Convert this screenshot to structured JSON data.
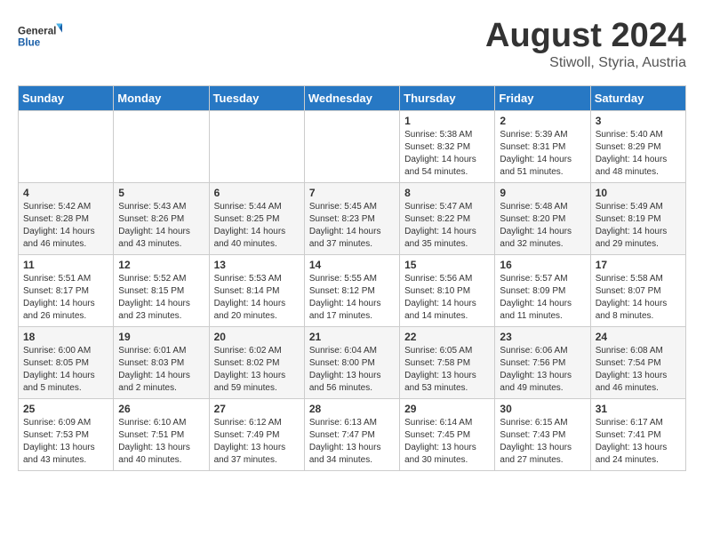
{
  "logo": {
    "text_general": "General",
    "text_blue": "Blue"
  },
  "title": "August 2024",
  "subtitle": "Stiwoll, Styria, Austria",
  "weekdays": [
    "Sunday",
    "Monday",
    "Tuesday",
    "Wednesday",
    "Thursday",
    "Friday",
    "Saturday"
  ],
  "weeks": [
    [
      {
        "day": "",
        "sunrise": "",
        "sunset": "",
        "daylight": ""
      },
      {
        "day": "",
        "sunrise": "",
        "sunset": "",
        "daylight": ""
      },
      {
        "day": "",
        "sunrise": "",
        "sunset": "",
        "daylight": ""
      },
      {
        "day": "",
        "sunrise": "",
        "sunset": "",
        "daylight": ""
      },
      {
        "day": "1",
        "sunrise": "Sunrise: 5:38 AM",
        "sunset": "Sunset: 8:32 PM",
        "daylight": "Daylight: 14 hours and 54 minutes."
      },
      {
        "day": "2",
        "sunrise": "Sunrise: 5:39 AM",
        "sunset": "Sunset: 8:31 PM",
        "daylight": "Daylight: 14 hours and 51 minutes."
      },
      {
        "day": "3",
        "sunrise": "Sunrise: 5:40 AM",
        "sunset": "Sunset: 8:29 PM",
        "daylight": "Daylight: 14 hours and 48 minutes."
      }
    ],
    [
      {
        "day": "4",
        "sunrise": "Sunrise: 5:42 AM",
        "sunset": "Sunset: 8:28 PM",
        "daylight": "Daylight: 14 hours and 46 minutes."
      },
      {
        "day": "5",
        "sunrise": "Sunrise: 5:43 AM",
        "sunset": "Sunset: 8:26 PM",
        "daylight": "Daylight: 14 hours and 43 minutes."
      },
      {
        "day": "6",
        "sunrise": "Sunrise: 5:44 AM",
        "sunset": "Sunset: 8:25 PM",
        "daylight": "Daylight: 14 hours and 40 minutes."
      },
      {
        "day": "7",
        "sunrise": "Sunrise: 5:45 AM",
        "sunset": "Sunset: 8:23 PM",
        "daylight": "Daylight: 14 hours and 37 minutes."
      },
      {
        "day": "8",
        "sunrise": "Sunrise: 5:47 AM",
        "sunset": "Sunset: 8:22 PM",
        "daylight": "Daylight: 14 hours and 35 minutes."
      },
      {
        "day": "9",
        "sunrise": "Sunrise: 5:48 AM",
        "sunset": "Sunset: 8:20 PM",
        "daylight": "Daylight: 14 hours and 32 minutes."
      },
      {
        "day": "10",
        "sunrise": "Sunrise: 5:49 AM",
        "sunset": "Sunset: 8:19 PM",
        "daylight": "Daylight: 14 hours and 29 minutes."
      }
    ],
    [
      {
        "day": "11",
        "sunrise": "Sunrise: 5:51 AM",
        "sunset": "Sunset: 8:17 PM",
        "daylight": "Daylight: 14 hours and 26 minutes."
      },
      {
        "day": "12",
        "sunrise": "Sunrise: 5:52 AM",
        "sunset": "Sunset: 8:15 PM",
        "daylight": "Daylight: 14 hours and 23 minutes."
      },
      {
        "day": "13",
        "sunrise": "Sunrise: 5:53 AM",
        "sunset": "Sunset: 8:14 PM",
        "daylight": "Daylight: 14 hours and 20 minutes."
      },
      {
        "day": "14",
        "sunrise": "Sunrise: 5:55 AM",
        "sunset": "Sunset: 8:12 PM",
        "daylight": "Daylight: 14 hours and 17 minutes."
      },
      {
        "day": "15",
        "sunrise": "Sunrise: 5:56 AM",
        "sunset": "Sunset: 8:10 PM",
        "daylight": "Daylight: 14 hours and 14 minutes."
      },
      {
        "day": "16",
        "sunrise": "Sunrise: 5:57 AM",
        "sunset": "Sunset: 8:09 PM",
        "daylight": "Daylight: 14 hours and 11 minutes."
      },
      {
        "day": "17",
        "sunrise": "Sunrise: 5:58 AM",
        "sunset": "Sunset: 8:07 PM",
        "daylight": "Daylight: 14 hours and 8 minutes."
      }
    ],
    [
      {
        "day": "18",
        "sunrise": "Sunrise: 6:00 AM",
        "sunset": "Sunset: 8:05 PM",
        "daylight": "Daylight: 14 hours and 5 minutes."
      },
      {
        "day": "19",
        "sunrise": "Sunrise: 6:01 AM",
        "sunset": "Sunset: 8:03 PM",
        "daylight": "Daylight: 14 hours and 2 minutes."
      },
      {
        "day": "20",
        "sunrise": "Sunrise: 6:02 AM",
        "sunset": "Sunset: 8:02 PM",
        "daylight": "Daylight: 13 hours and 59 minutes."
      },
      {
        "day": "21",
        "sunrise": "Sunrise: 6:04 AM",
        "sunset": "Sunset: 8:00 PM",
        "daylight": "Daylight: 13 hours and 56 minutes."
      },
      {
        "day": "22",
        "sunrise": "Sunrise: 6:05 AM",
        "sunset": "Sunset: 7:58 PM",
        "daylight": "Daylight: 13 hours and 53 minutes."
      },
      {
        "day": "23",
        "sunrise": "Sunrise: 6:06 AM",
        "sunset": "Sunset: 7:56 PM",
        "daylight": "Daylight: 13 hours and 49 minutes."
      },
      {
        "day": "24",
        "sunrise": "Sunrise: 6:08 AM",
        "sunset": "Sunset: 7:54 PM",
        "daylight": "Daylight: 13 hours and 46 minutes."
      }
    ],
    [
      {
        "day": "25",
        "sunrise": "Sunrise: 6:09 AM",
        "sunset": "Sunset: 7:53 PM",
        "daylight": "Daylight: 13 hours and 43 minutes."
      },
      {
        "day": "26",
        "sunrise": "Sunrise: 6:10 AM",
        "sunset": "Sunset: 7:51 PM",
        "daylight": "Daylight: 13 hours and 40 minutes."
      },
      {
        "day": "27",
        "sunrise": "Sunrise: 6:12 AM",
        "sunset": "Sunset: 7:49 PM",
        "daylight": "Daylight: 13 hours and 37 minutes."
      },
      {
        "day": "28",
        "sunrise": "Sunrise: 6:13 AM",
        "sunset": "Sunset: 7:47 PM",
        "daylight": "Daylight: 13 hours and 34 minutes."
      },
      {
        "day": "29",
        "sunrise": "Sunrise: 6:14 AM",
        "sunset": "Sunset: 7:45 PM",
        "daylight": "Daylight: 13 hours and 30 minutes."
      },
      {
        "day": "30",
        "sunrise": "Sunrise: 6:15 AM",
        "sunset": "Sunset: 7:43 PM",
        "daylight": "Daylight: 13 hours and 27 minutes."
      },
      {
        "day": "31",
        "sunrise": "Sunrise: 6:17 AM",
        "sunset": "Sunset: 7:41 PM",
        "daylight": "Daylight: 13 hours and 24 minutes."
      }
    ]
  ]
}
